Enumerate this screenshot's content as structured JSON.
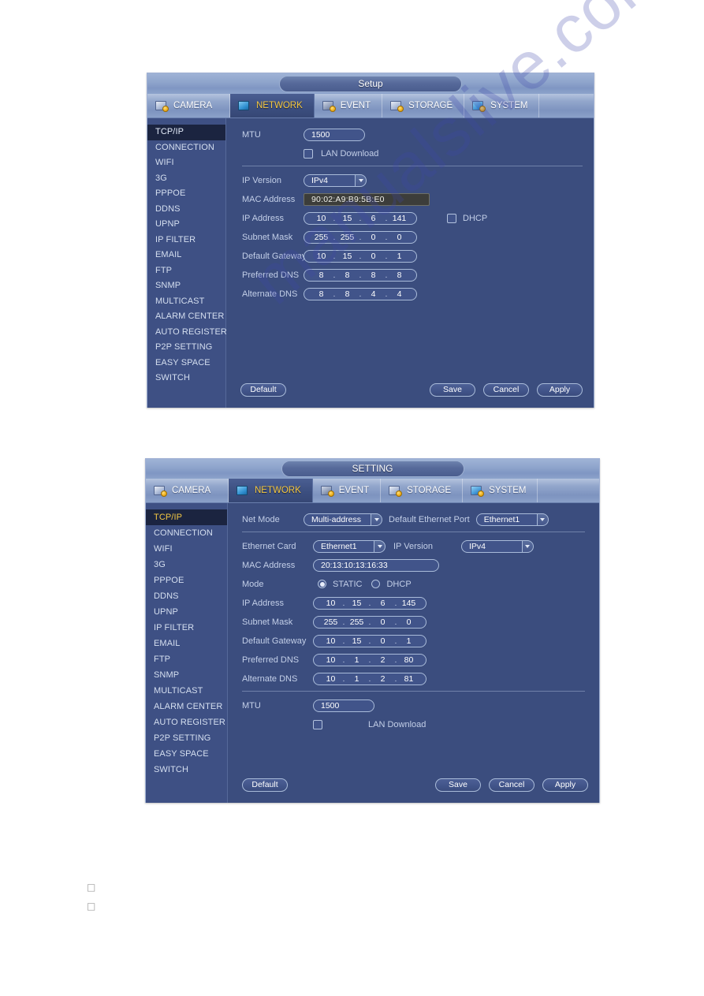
{
  "watermark": "manualslive.com",
  "sidebar_items": [
    "TCP/IP",
    "CONNECTION",
    "WIFI",
    "3G",
    "PPPOE",
    "DDNS",
    "UPNP",
    "IP FILTER",
    "EMAIL",
    "FTP",
    "SNMP",
    "MULTICAST",
    "ALARM CENTER",
    "AUTO REGISTER",
    "P2P SETTING",
    "EASY SPACE",
    "SWITCH"
  ],
  "tabs": [
    {
      "label": "CAMERA",
      "icon": "camera-icon",
      "active": false
    },
    {
      "label": "NETWORK",
      "icon": "network-icon",
      "active": true
    },
    {
      "label": "EVENT",
      "icon": "event-icon",
      "active": false
    },
    {
      "label": "STORAGE",
      "icon": "storage-icon",
      "active": false
    },
    {
      "label": "SYSTEM",
      "icon": "system-icon",
      "active": false
    }
  ],
  "dialog1": {
    "title": "Setup",
    "active_sidebar": "TCP/IP",
    "mtu": {
      "label": "MTU",
      "value": "1500"
    },
    "lan_download": {
      "label": "LAN Download",
      "checked": false
    },
    "ip_version": {
      "label": "IP Version",
      "value": "IPv4"
    },
    "mac_address": {
      "label": "MAC Address",
      "value": "90:02:A9:B9:5B:E0"
    },
    "ip_address": {
      "label": "IP Address",
      "octets": [
        "10",
        "15",
        "6",
        "141"
      ]
    },
    "subnet_mask": {
      "label": "Subnet Mask",
      "octets": [
        "255",
        "255",
        "0",
        "0"
      ]
    },
    "default_gateway": {
      "label": "Default Gateway",
      "octets": [
        "10",
        "15",
        "0",
        "1"
      ]
    },
    "preferred_dns": {
      "label": "Preferred DNS",
      "octets": [
        "8",
        "8",
        "8",
        "8"
      ]
    },
    "alternate_dns": {
      "label": "Alternate DNS",
      "octets": [
        "8",
        "8",
        "4",
        "4"
      ]
    },
    "dhcp": {
      "label": "DHCP",
      "checked": false
    },
    "buttons": {
      "default": "Default",
      "save": "Save",
      "cancel": "Cancel",
      "apply": "Apply"
    }
  },
  "dialog2": {
    "title": "SETTING",
    "active_sidebar": "TCP/IP",
    "net_mode": {
      "label": "Net Mode",
      "value": "Multi-address"
    },
    "default_ethernet_port": {
      "label": "Default Ethernet Port",
      "value": "Ethernet1"
    },
    "ethernet_card": {
      "label": "Ethernet Card",
      "value": "Ethernet1"
    },
    "ip_version": {
      "label": "IP Version",
      "value": "IPv4"
    },
    "mac_address": {
      "label": "MAC Address",
      "value": "20:13:10:13:16:33"
    },
    "mode": {
      "label": "Mode",
      "static_label": "STATIC",
      "dhcp_label": "DHCP",
      "selected": "STATIC"
    },
    "ip_address": {
      "label": "IP Address",
      "octets": [
        "10",
        "15",
        "6",
        "145"
      ]
    },
    "subnet_mask": {
      "label": "Subnet Mask",
      "octets": [
        "255",
        "255",
        "0",
        "0"
      ]
    },
    "default_gateway": {
      "label": "Default Gateway",
      "octets": [
        "10",
        "15",
        "0",
        "1"
      ]
    },
    "preferred_dns": {
      "label": "Preferred DNS",
      "octets": [
        "10",
        "1",
        "2",
        "80"
      ]
    },
    "alternate_dns": {
      "label": "Alternate DNS",
      "octets": [
        "10",
        "1",
        "2",
        "81"
      ]
    },
    "mtu": {
      "label": "MTU",
      "value": "1500"
    },
    "lan_download": {
      "label": "LAN Download",
      "checked": false
    },
    "buttons": {
      "default": "Default",
      "save": "Save",
      "cancel": "Cancel",
      "apply": "Apply"
    }
  },
  "bottom_glyphs": [
    "□",
    "□"
  ],
  "colors": {
    "panel": "#3b4d7e",
    "sidebar": "#3e5084",
    "accent": "#f5c842",
    "border": "#a9bbd9"
  }
}
